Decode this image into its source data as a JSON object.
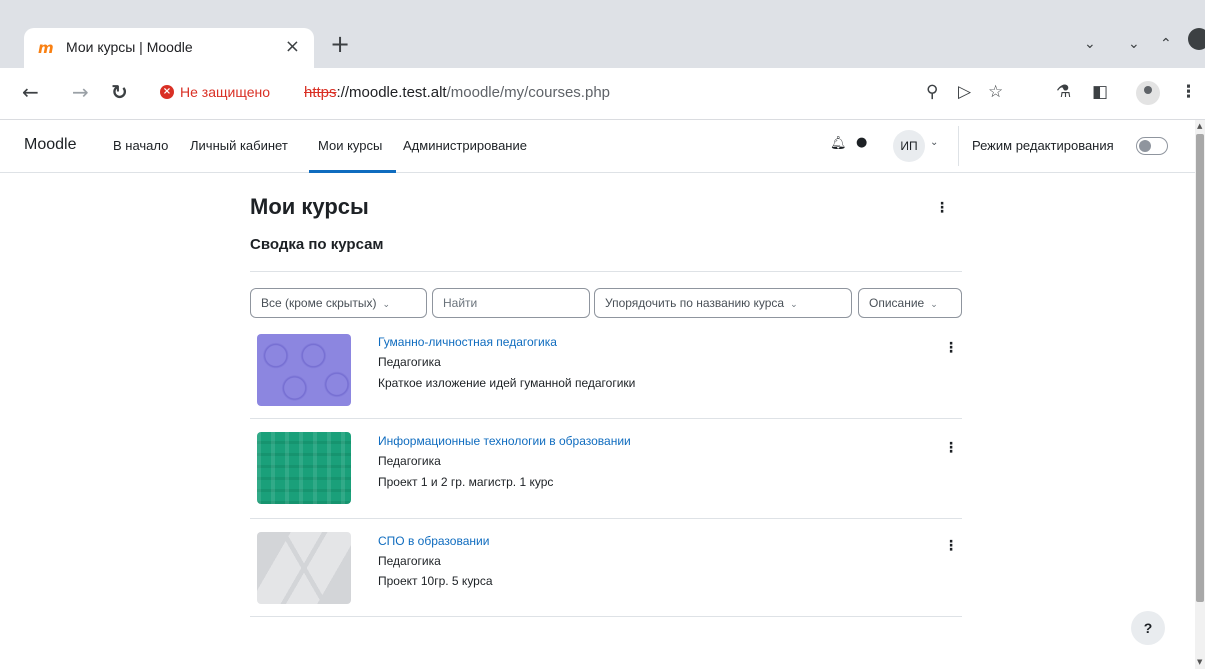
{
  "browser": {
    "tab_title": "Мои курсы | Moodle",
    "tab_favicon": "m",
    "new_tab": "+",
    "insecure_label": "Не защищено",
    "url_scheme": "https",
    "url_host": "://moodle.test.alt",
    "url_path": "/moodle/my/courses.php"
  },
  "navbar": {
    "brand": "Moodle",
    "items": [
      {
        "label": "В начало"
      },
      {
        "label": "Личный кабинет"
      },
      {
        "label": "Мои курсы",
        "active": true
      },
      {
        "label": "Администрирование"
      }
    ],
    "user_initials": "ИП",
    "edit_mode_label": "Режим редактирования",
    "edit_mode_on": false
  },
  "page": {
    "title": "Мои курсы",
    "section_title": "Сводка по курсам",
    "filter_label": "Все (кроме скрытых)",
    "search_placeholder": "Найти",
    "sort_label": "Упорядочить по названию курса",
    "view_label": "Описание"
  },
  "courses": [
    {
      "name": "Гуманно-личностная педагогика",
      "category": "Педагогика",
      "summary": "Краткое изложение идей гуманной педагогики",
      "image": "purple-circles-pattern"
    },
    {
      "name": "Информационные технологии в образовании",
      "category": "Педагогика",
      "summary": "Проект 1 и 2 гр. магистр. 1 курс",
      "image": "green-plaid-pattern"
    },
    {
      "name": "СПО в образовании",
      "category": "Педагогика",
      "summary": "Проект 10гр. 5 курса",
      "image": "grey-triangles-pattern"
    }
  ],
  "help_label": "?",
  "icons": {
    "back": "arrow-left-icon",
    "forward": "arrow-right-icon",
    "reload": "reload-icon",
    "zoom": "zoom-icon",
    "share": "send-icon",
    "bookmark": "star-icon",
    "labs": "flask-icon",
    "sidepanel": "side-panel-icon",
    "menu": "kebab-icon",
    "bell": "bell-icon",
    "chat": "chat-icon"
  },
  "colors": {
    "accent": "#0f6cbf",
    "warning": "#d93025",
    "tabbar": "#dee1e6"
  }
}
